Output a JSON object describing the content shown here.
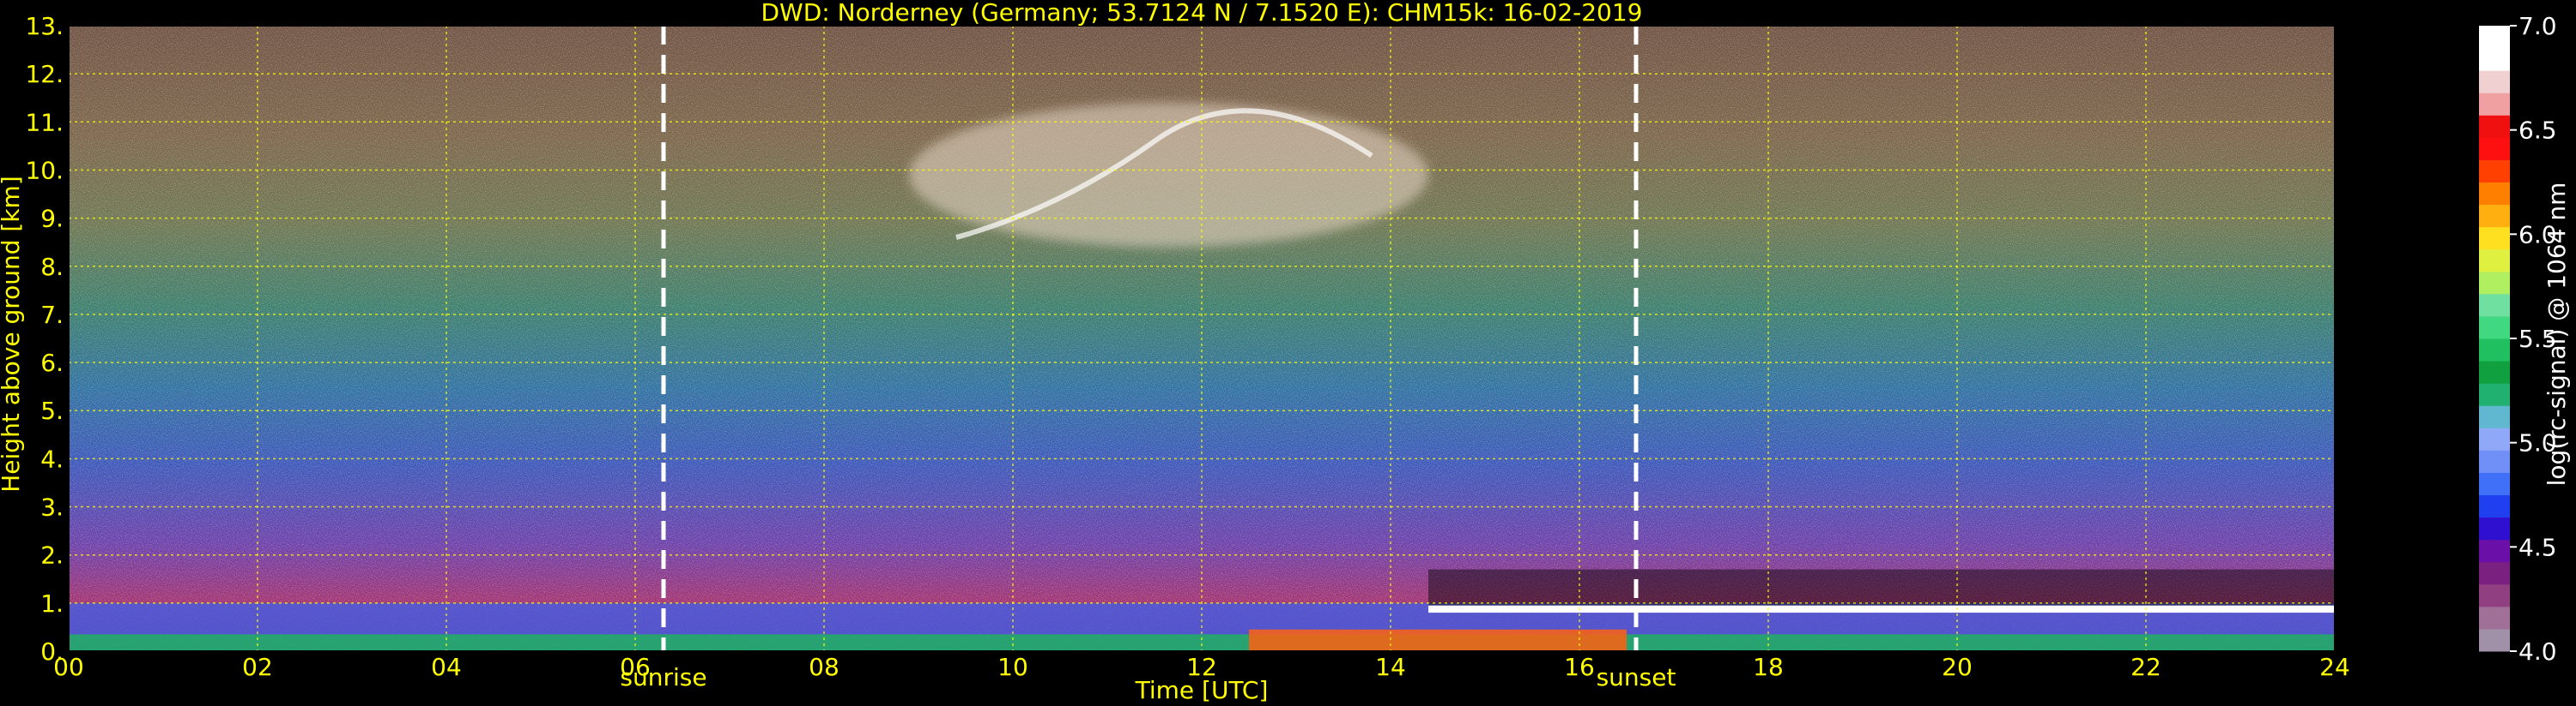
{
  "chart_data": {
    "type": "heatmap",
    "title": "DWD: Norderney (Germany; 53.7124 N / 7.1520 E):    CHM15k: 16-02-2019",
    "xlabel": "Time [UTC]",
    "ylabel": "Height above ground [km]",
    "xlim": [
      0,
      24
    ],
    "ylim": [
      0,
      13
    ],
    "x_ticks": [
      0,
      2,
      4,
      6,
      8,
      10,
      12,
      14,
      16,
      18,
      20,
      22,
      24
    ],
    "x_tick_labels": [
      "00",
      "02",
      "04",
      "06",
      "08",
      "10",
      "12",
      "14",
      "16",
      "18",
      "20",
      "22",
      "24"
    ],
    "y_ticks": [
      0,
      1,
      2,
      3,
      4,
      5,
      6,
      7,
      8,
      9,
      10,
      11,
      12,
      13
    ],
    "y_tick_labels": [
      "0.",
      "1.",
      "2.",
      "3.",
      "4.",
      "5.",
      "6.",
      "7.",
      "8.",
      "9.",
      "10.",
      "11.",
      "12.",
      "13."
    ],
    "grid": true,
    "events": [
      {
        "label": "sunrise",
        "time": 6.3
      },
      {
        "label": "sunset",
        "time": 16.6
      }
    ],
    "colorbar": {
      "label": "log(rc-signal) @ 1064 nm",
      "range": [
        4.0,
        7.0
      ],
      "ticks": [
        4.0,
        4.5,
        5.0,
        5.5,
        6.0,
        6.5,
        7.0
      ],
      "tick_labels": [
        "4.0",
        "4.5",
        "5.0",
        "5.5",
        "6.0",
        "6.5",
        "7.0"
      ],
      "colors": [
        "#a090a8",
        "#a07098",
        "#904080",
        "#7a2080",
        "#6a10a8",
        "#3010d0",
        "#2040f0",
        "#4070f8",
        "#7090f8",
        "#90a8f8",
        "#60b8d0",
        "#20b070",
        "#10a040",
        "#20c060",
        "#40d880",
        "#70e0a0",
        "#b0f060",
        "#e0f040",
        "#ffe020",
        "#ffb010",
        "#ff8000",
        "#ff4000",
        "#ff1010",
        "#f01010",
        "#f0a0a0",
        "#f0d0d0",
        "#ffffff",
        "#ffffff"
      ]
    },
    "features": [
      {
        "type": "cirrus cloud",
        "time_range": [
          8.9,
          14.4
        ],
        "height_range_km": [
          8.4,
          11.4
        ]
      },
      {
        "type": "boundary layer aerosol",
        "time_range": [
          0,
          24
        ],
        "height_range_km": [
          0,
          1.0
        ]
      },
      {
        "type": "low cloud top",
        "time_range": [
          14.4,
          24
        ],
        "height_km": 0.8
      }
    ]
  }
}
